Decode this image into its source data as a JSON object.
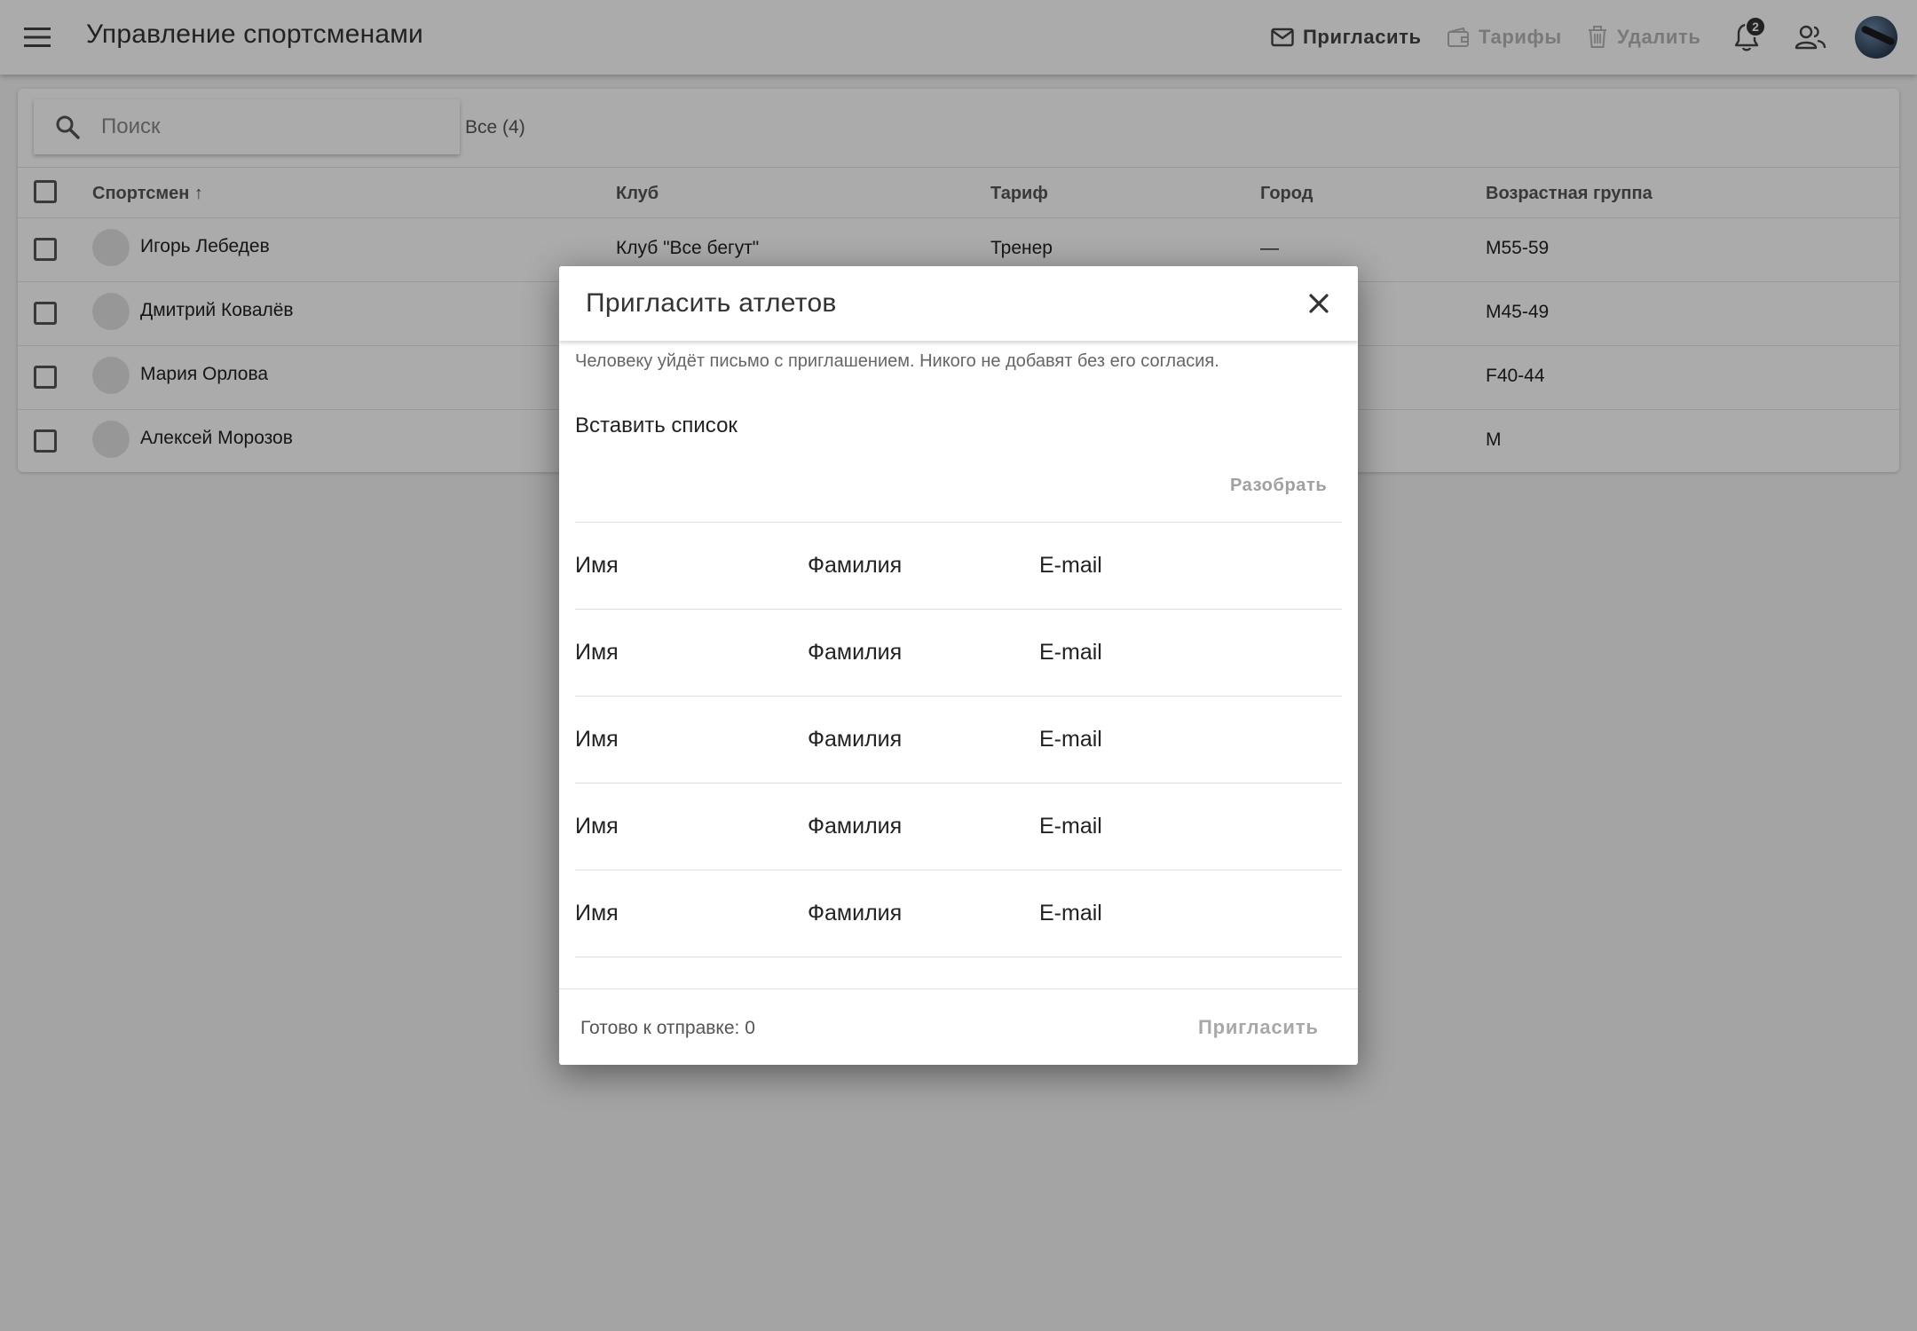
{
  "appbar": {
    "title": "Управление спортсменами",
    "invite_label": "Пригласить",
    "tariffs_label": "Тарифы",
    "delete_label": "Удалить",
    "notifications_count": "2"
  },
  "toolbar": {
    "search_placeholder": "Поиск",
    "filter_all": "Все (4)"
  },
  "table": {
    "headers": {
      "athlete": "Спортсмен ↑",
      "club": "Клуб",
      "tariff": "Тариф",
      "city": "Город",
      "age_group": "Возрастная группа"
    },
    "rows": [
      {
        "name": "Игорь Лебедев",
        "club": "Клуб \"Все бегут\"",
        "tariff": "Тренер",
        "city": "—",
        "age": "M55-59"
      },
      {
        "name": "Дмитрий Ковалёв",
        "club": "",
        "tariff": "",
        "city": "",
        "age": "M45-49"
      },
      {
        "name": "Мария Орлова",
        "club": "",
        "tariff": "",
        "city": "",
        "age": "F40-44"
      },
      {
        "name": "Алексей Морозов",
        "club": "",
        "tariff": "",
        "city": "",
        "age": "M"
      }
    ]
  },
  "modal": {
    "title": "Пригласить атлетов",
    "hint": "Человеку уйдёт письмо с приглашением. Никого не добавят без его согласия.",
    "paste_label": "Вставить список",
    "parse_label": "Разобрать",
    "invite_rows": [
      {
        "first": "Имя",
        "last": "Фамилия",
        "email": "E-mail"
      },
      {
        "first": "Имя",
        "last": "Фамилия",
        "email": "E-mail"
      },
      {
        "first": "Имя",
        "last": "Фамилия",
        "email": "E-mail"
      },
      {
        "first": "Имя",
        "last": "Фамилия",
        "email": "E-mail"
      },
      {
        "first": "Имя",
        "last": "Фамилия",
        "email": "E-mail"
      }
    ],
    "ready_text": "Готово к отправке: 0",
    "invite_button": "Пригласить"
  }
}
